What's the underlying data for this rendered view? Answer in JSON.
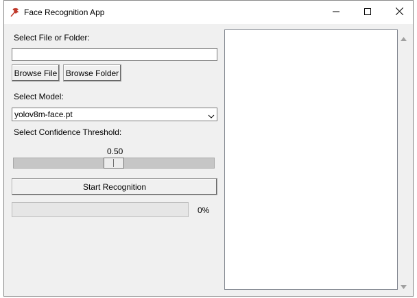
{
  "window": {
    "title": "Face Recognition App",
    "icon": "feather-icon",
    "controls": [
      "minimize-icon",
      "maximize-icon",
      "close-icon"
    ]
  },
  "file_section": {
    "label": "Select File or Folder:",
    "path_value": "",
    "browse_file_label": "Browse File",
    "browse_folder_label": "Browse Folder"
  },
  "model_section": {
    "label": "Select Model:",
    "selected": "yolov8m-face.pt"
  },
  "threshold_section": {
    "label": "Select Confidence Threshold:",
    "value_text": "0.50",
    "value": 0.5,
    "min": 0,
    "max": 1
  },
  "start_button_label": "Start Recognition",
  "progress": {
    "value": 0,
    "text": "0%"
  },
  "output": {
    "text": ""
  },
  "colors": {
    "window_bg": "#f0f0f0",
    "titlebar_bg": "#ffffff",
    "progress_fill": "#06b025",
    "icon_red": "#c0392b"
  }
}
